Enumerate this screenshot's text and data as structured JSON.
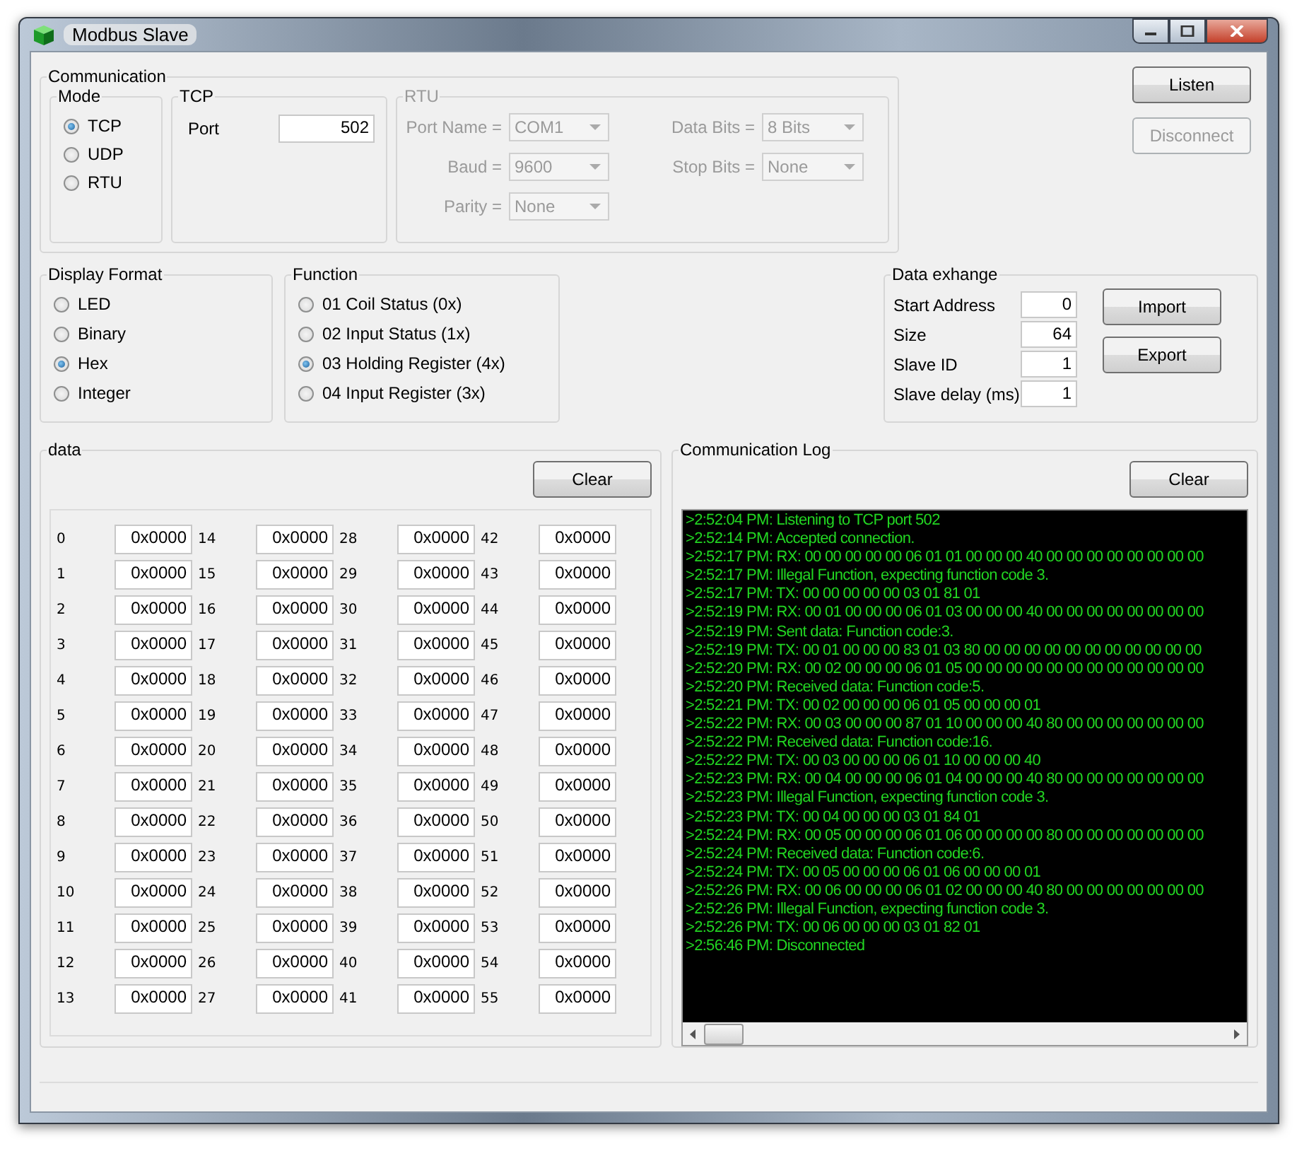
{
  "window": {
    "title": "Modbus Slave"
  },
  "communication": {
    "title": "Communication",
    "mode": {
      "title": "Mode",
      "options": [
        {
          "label": "TCP",
          "selected": true
        },
        {
          "label": "UDP",
          "selected": false
        },
        {
          "label": "RTU",
          "selected": false
        }
      ]
    },
    "tcp": {
      "title": "TCP",
      "port_label": "Port",
      "port": "502"
    },
    "rtu": {
      "title": "RTU",
      "disabled": true,
      "fields": [
        {
          "label": "Port Name =",
          "value": "COM1"
        },
        {
          "label": "Data Bits =",
          "value": "8 Bits"
        },
        {
          "label": "Baud =",
          "value": "9600"
        },
        {
          "label": "Stop Bits =",
          "value": "None"
        },
        {
          "label": "Parity =",
          "value": "None"
        }
      ]
    }
  },
  "connection_buttons": [
    {
      "label": "Listen",
      "disabled": false
    },
    {
      "label": "Disconnect",
      "disabled": true
    }
  ],
  "display_format": {
    "title": "Display Format",
    "options": [
      {
        "label": "LED",
        "selected": false
      },
      {
        "label": "Binary",
        "selected": false
      },
      {
        "label": "Hex",
        "selected": true
      },
      {
        "label": "Integer",
        "selected": false
      }
    ]
  },
  "function": {
    "title": "Function",
    "options": [
      {
        "label": "01 Coil Status (0x)",
        "selected": false
      },
      {
        "label": "02 Input Status (1x)",
        "selected": false
      },
      {
        "label": "03 Holding Register (4x)",
        "selected": true
      },
      {
        "label": "04 Input Register (3x)",
        "selected": false
      }
    ]
  },
  "data_exchange": {
    "title": "Data exhange",
    "fields": [
      {
        "label": "Start Address",
        "value": "0"
      },
      {
        "label": "Size",
        "value": "64"
      },
      {
        "label": "Slave ID",
        "value": "1"
      },
      {
        "label": "Slave delay (ms)",
        "value": "1"
      }
    ],
    "buttons": [
      "Import",
      "Export"
    ]
  },
  "data": {
    "title": "data",
    "clear_button": "Clear",
    "registers": [
      {
        "address": "0",
        "value": "0x0000"
      },
      {
        "address": "1",
        "value": "0x0000"
      },
      {
        "address": "2",
        "value": "0x0000"
      },
      {
        "address": "3",
        "value": "0x0000"
      },
      {
        "address": "4",
        "value": "0x0000"
      },
      {
        "address": "5",
        "value": "0x0000"
      },
      {
        "address": "6",
        "value": "0x0000"
      },
      {
        "address": "7",
        "value": "0x0000"
      },
      {
        "address": "8",
        "value": "0x0000"
      },
      {
        "address": "9",
        "value": "0x0000"
      },
      {
        "address": "10",
        "value": "0x0000"
      },
      {
        "address": "11",
        "value": "0x0000"
      },
      {
        "address": "12",
        "value": "0x0000"
      },
      {
        "address": "13",
        "value": "0x0000"
      },
      {
        "address": "14",
        "value": "0x0000"
      },
      {
        "address": "15",
        "value": "0x0000"
      },
      {
        "address": "16",
        "value": "0x0000"
      },
      {
        "address": "17",
        "value": "0x0000"
      },
      {
        "address": "18",
        "value": "0x0000"
      },
      {
        "address": "19",
        "value": "0x0000"
      },
      {
        "address": "20",
        "value": "0x0000"
      },
      {
        "address": "21",
        "value": "0x0000"
      },
      {
        "address": "22",
        "value": "0x0000"
      },
      {
        "address": "23",
        "value": "0x0000"
      },
      {
        "address": "24",
        "value": "0x0000"
      },
      {
        "address": "25",
        "value": "0x0000"
      },
      {
        "address": "26",
        "value": "0x0000"
      },
      {
        "address": "27",
        "value": "0x0000"
      },
      {
        "address": "28",
        "value": "0x0000"
      },
      {
        "address": "29",
        "value": "0x0000"
      },
      {
        "address": "30",
        "value": "0x0000"
      },
      {
        "address": "31",
        "value": "0x0000"
      },
      {
        "address": "32",
        "value": "0x0000"
      },
      {
        "address": "33",
        "value": "0x0000"
      },
      {
        "address": "34",
        "value": "0x0000"
      },
      {
        "address": "35",
        "value": "0x0000"
      },
      {
        "address": "36",
        "value": "0x0000"
      },
      {
        "address": "37",
        "value": "0x0000"
      },
      {
        "address": "38",
        "value": "0x0000"
      },
      {
        "address": "39",
        "value": "0x0000"
      },
      {
        "address": "40",
        "value": "0x0000"
      },
      {
        "address": "41",
        "value": "0x0000"
      },
      {
        "address": "42",
        "value": "0x0000"
      },
      {
        "address": "43",
        "value": "0x0000"
      },
      {
        "address": "44",
        "value": "0x0000"
      },
      {
        "address": "45",
        "value": "0x0000"
      },
      {
        "address": "46",
        "value": "0x0000"
      },
      {
        "address": "47",
        "value": "0x0000"
      },
      {
        "address": "48",
        "value": "0x0000"
      },
      {
        "address": "49",
        "value": "0x0000"
      },
      {
        "address": "50",
        "value": "0x0000"
      },
      {
        "address": "51",
        "value": "0x0000"
      },
      {
        "address": "52",
        "value": "0x0000"
      },
      {
        "address": "53",
        "value": "0x0000"
      },
      {
        "address": "54",
        "value": "0x0000"
      },
      {
        "address": "55",
        "value": "0x0000"
      }
    ]
  },
  "log": {
    "title": "Communication Log",
    "clear_button": "Clear",
    "lines": [
      ">2:52:04 PM: Listening to TCP port 502",
      ">2:52:14 PM: Accepted connection.",
      ">2:52:17 PM: RX: 00 00 00 00 00 06 01 01 00 00 00 40 00 00 00 00 00 00 00 00",
      ">2:52:17 PM: Illegal Function, expecting function code 3.",
      ">2:52:17 PM: TX: 00 00 00 00 00 03 01 81 01",
      ">2:52:19 PM: RX: 00 01 00 00 00 06 01 03 00 00 00 40 00 00 00 00 00 00 00 00",
      ">2:52:19 PM: Sent data: Function code:3.",
      ">2:52:19 PM: TX: 00 01 00 00 00 83 01 03 80 00 00 00 00 00 00 00 00 00 00 00",
      ">2:52:20 PM: RX: 00 02 00 00 00 06 01 05 00 00 00 00 00 00 00 00 00 00 00 00",
      ">2:52:20 PM: Received data: Function code:5.",
      ">2:52:21 PM: TX: 00 02 00 00 00 06 01 05 00 00 00 01",
      ">2:52:22 PM: RX: 00 03 00 00 00 87 01 10 00 00 00 40 80 00 00 00 00 00 00 00",
      ">2:52:22 PM: Received data: Function code:16.",
      ">2:52:22 PM: TX: 00 03 00 00 00 06 01 10 00 00 00 40",
      ">2:52:23 PM: RX: 00 04 00 00 00 06 01 04 00 00 00 40 80 00 00 00 00 00 00 00",
      ">2:52:23 PM: Illegal Function, expecting function code 3.",
      ">2:52:23 PM: TX: 00 04 00 00 00 03 01 84 01",
      ">2:52:24 PM: RX: 00 05 00 00 00 06 01 06 00 00 00 00 80 00 00 00 00 00 00 00",
      ">2:52:24 PM: Received data: Function code:6.",
      ">2:52:24 PM: TX: 00 05 00 00 00 06 01 06 00 00 00 01",
      ">2:52:26 PM: RX: 00 06 00 00 00 06 01 02 00 00 00 40 80 00 00 00 00 00 00 00",
      ">2:52:26 PM: Illegal Function, expecting function code 3.",
      ">2:52:26 PM: TX: 00 06 00 00 00 03 01 82 01",
      ">2:56:46 PM: Disconnected"
    ]
  }
}
